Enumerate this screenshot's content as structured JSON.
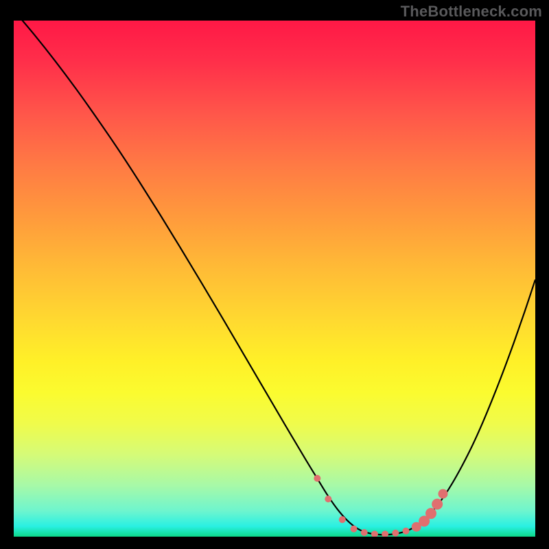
{
  "watermark": "TheBottleneck.com",
  "colors": {
    "curve_stroke": "#000000",
    "marker_fill": "#e06f6f",
    "marker_stroke": "#cf5a5a"
  },
  "chart_data": {
    "type": "line",
    "title": "",
    "xlabel": "",
    "ylabel": "",
    "xlim": [
      0,
      100
    ],
    "ylim": [
      0,
      100
    ],
    "grid": false,
    "legend": false,
    "series": [
      {
        "name": "bottleneck_curve",
        "x": [
          0,
          4,
          8,
          12,
          16,
          20,
          24,
          28,
          32,
          36,
          40,
          44,
          48,
          52,
          56,
          58,
          60,
          62,
          64,
          66,
          68,
          70,
          72,
          74,
          76,
          78,
          80,
          82,
          84,
          86,
          88,
          90,
          92,
          94,
          96,
          98,
          100
        ],
        "y": [
          102,
          97.2,
          92.1,
          86.7,
          81.0,
          75.1,
          68.9,
          62.5,
          55.9,
          49.2,
          42.4,
          35.5,
          28.6,
          21.7,
          14.9,
          11.6,
          8.3,
          5.4,
          3.1,
          1.5,
          0.7,
          0.4,
          0.4,
          0.7,
          1.4,
          2.7,
          4.6,
          7.1,
          10.2,
          13.8,
          17.8,
          22.3,
          27.2,
          32.4,
          37.9,
          43.7,
          49.8
        ]
      }
    ],
    "markers": {
      "series": "bottleneck_curve",
      "points": [
        {
          "x": 58.2,
          "y": 11.3,
          "r": 5
        },
        {
          "x": 60.3,
          "y": 7.3,
          "r": 5
        },
        {
          "x": 63.0,
          "y": 3.3,
          "r": 5
        },
        {
          "x": 65.2,
          "y": 1.5,
          "r": 5
        },
        {
          "x": 67.2,
          "y": 0.8,
          "r": 5
        },
        {
          "x": 69.2,
          "y": 0.5,
          "r": 5
        },
        {
          "x": 71.2,
          "y": 0.5,
          "r": 5
        },
        {
          "x": 73.2,
          "y": 0.7,
          "r": 5
        },
        {
          "x": 75.2,
          "y": 1.1,
          "r": 5
        },
        {
          "x": 77.2,
          "y": 1.9,
          "r": 7
        },
        {
          "x": 78.7,
          "y": 3.0,
          "r": 8
        },
        {
          "x": 80.0,
          "y": 4.5,
          "r": 8
        },
        {
          "x": 81.2,
          "y": 6.3,
          "r": 8
        },
        {
          "x": 82.3,
          "y": 8.3,
          "r": 7
        }
      ]
    }
  }
}
